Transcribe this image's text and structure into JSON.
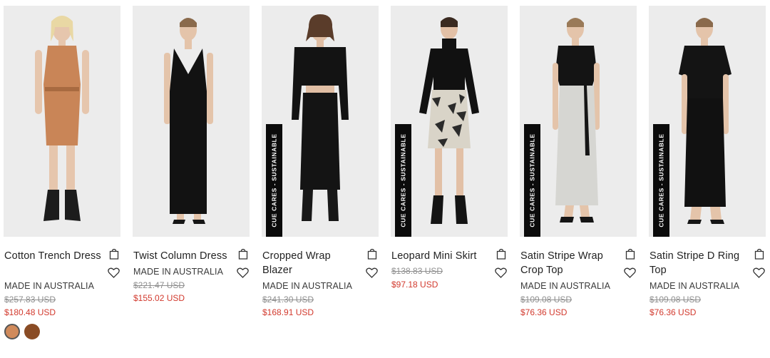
{
  "products": [
    {
      "name": "Cotton Trench Dress",
      "made": "MADE IN AUSTRALIA",
      "was": "$257.83 USD",
      "now": "$180.48 USD",
      "badge": "",
      "swatches": [
        "#d08a5b",
        "#8a4c25"
      ]
    },
    {
      "name": "Twist Column Dress",
      "made": "MADE IN AUSTRALIA",
      "was": "$221.47 USD",
      "now": "$155.02 USD",
      "badge": "",
      "swatches": []
    },
    {
      "name": "Cropped Wrap Blazer",
      "made": "MADE IN AUSTRALIA",
      "was": "$241.30 USD",
      "now": "$168.91 USD",
      "badge": "CUE CARES - SUSTAINABLE",
      "swatches": []
    },
    {
      "name": "Leopard Mini Skirt",
      "made": "",
      "was": "$138.83 USD",
      "now": "$97.18 USD",
      "badge": "CUE CARES - SUSTAINABLE",
      "swatches": []
    },
    {
      "name": "Satin Stripe Wrap Crop Top",
      "made": "MADE IN AUSTRALIA",
      "was": "$109.08 USD",
      "now": "$76.36 USD",
      "badge": "CUE CARES - SUSTAINABLE",
      "swatches": []
    },
    {
      "name": "Satin Stripe D Ring Top",
      "made": "MADE IN AUSTRALIA",
      "was": "$109.08 USD",
      "now": "$76.36 USD",
      "badge": "CUE CARES - SUSTAINABLE",
      "swatches": []
    }
  ],
  "icons": {
    "bag": "shopping-bag-icon",
    "wishlist": "heart-icon"
  },
  "colors": {
    "sale_price": "#d23a2e",
    "old_price": "#8f8f8f",
    "badge_bg": "#0b0b0b",
    "photo_bg": "#ececec"
  }
}
